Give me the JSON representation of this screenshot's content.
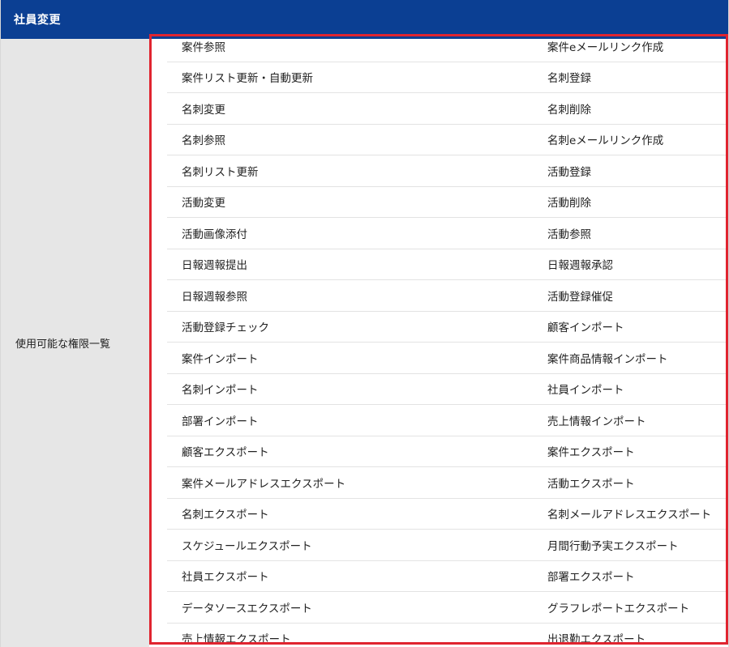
{
  "header": {
    "title": "社員変更"
  },
  "label": {
    "permissions_label": "使用可能な権限一覧"
  },
  "permissions": [
    [
      "案件参照",
      "案件eメールリンク作成"
    ],
    [
      "案件リスト更新・自動更新",
      "名刺登録"
    ],
    [
      "名刺変更",
      "名刺削除"
    ],
    [
      "名刺参照",
      "名刺eメールリンク作成"
    ],
    [
      "名刺リスト更新",
      "活動登録"
    ],
    [
      "活動変更",
      "活動削除"
    ],
    [
      "活動画像添付",
      "活動参照"
    ],
    [
      "日報週報提出",
      "日報週報承認"
    ],
    [
      "日報週報参照",
      "活動登録催促"
    ],
    [
      "活動登録チェック",
      "顧客インポート"
    ],
    [
      "案件インポート",
      "案件商品情報インポート"
    ],
    [
      "名刺インポート",
      "社員インポート"
    ],
    [
      "部署インポート",
      "売上情報インポート"
    ],
    [
      "顧客エクスポート",
      "案件エクスポート"
    ],
    [
      "案件メールアドレスエクスポート",
      "活動エクスポート"
    ],
    [
      "名刺エクスポート",
      "名刺メールアドレスエクスポート"
    ],
    [
      "スケジュールエクスポート",
      "月間行動予実エクスポート"
    ],
    [
      "社員エクスポート",
      "部署エクスポート"
    ],
    [
      "データソースエクスポート",
      "グラフレポートエクスポート"
    ],
    [
      "売上情報エクスポート",
      "出退勤エクスポート"
    ]
  ],
  "colors": {
    "header_bg": "#0b3f93",
    "label_bg": "#e6e6e6",
    "highlight": "#e0242f"
  }
}
